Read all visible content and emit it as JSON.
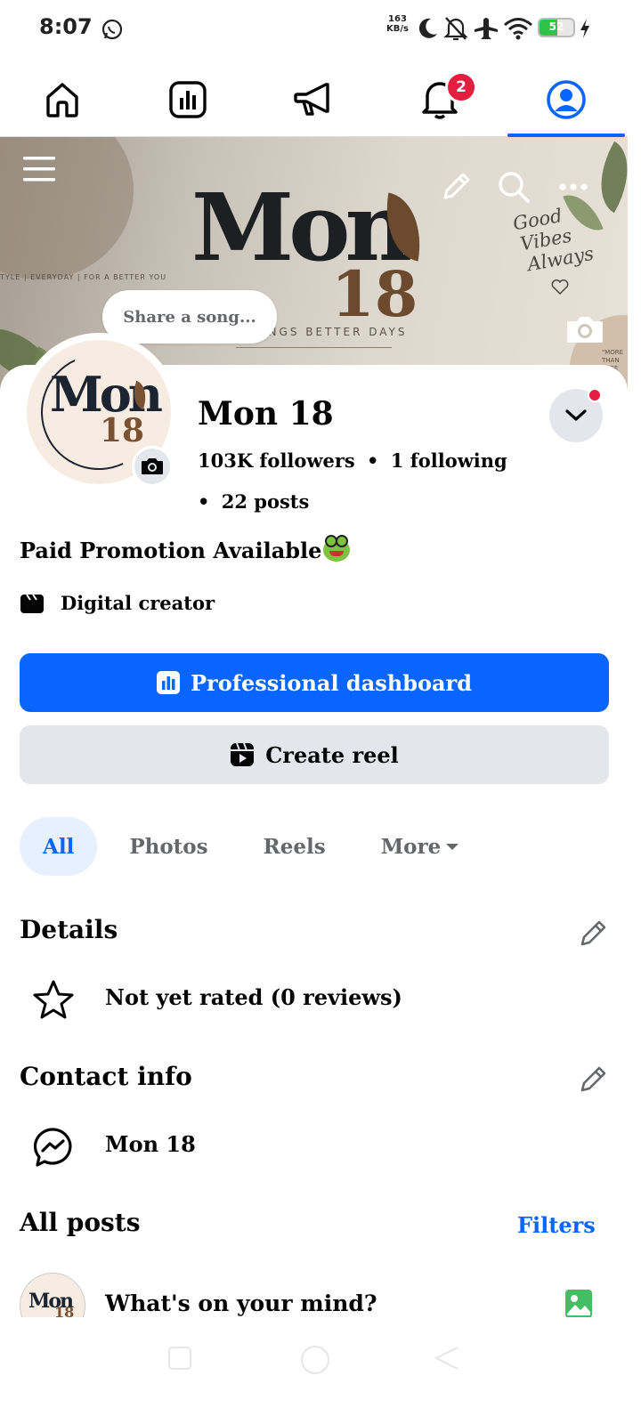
{
  "status_bar": {
    "time": "8:07",
    "net_speed_value": "163",
    "net_speed_unit": "KB/s",
    "battery": "52",
    "battery_level": 0.52,
    "icons": [
      "whatsapp-icon",
      "moon-icon",
      "bell-off-icon",
      "airplane-icon",
      "wifi-icon",
      "battery-icon",
      "charging-icon"
    ]
  },
  "top_nav": {
    "tabs": [
      {
        "name": "home",
        "icon": "home-icon"
      },
      {
        "name": "dashboard",
        "icon": "chart-icon"
      },
      {
        "name": "ads",
        "icon": "megaphone-icon"
      },
      {
        "name": "notifications",
        "icon": "bell-icon",
        "badge": "2"
      },
      {
        "name": "profile",
        "icon": "profile-icon",
        "active": true
      }
    ],
    "accent_color": "#0866ff"
  },
  "cover": {
    "brand": "Mon",
    "brand_number": "18",
    "left_line": "TYLE  |  EVERYDAY  |  FOR A BETTER YOU",
    "tagline": "INGS   BETTER DAYS",
    "script_line1": "Good",
    "script_line2": "Vibes",
    "script_line3": "Always",
    "small_text_1": "\"MORE",
    "small_text_2": "THAN",
    "small_text_3": "PAGE"
  },
  "share_song": "Share a song...",
  "profile": {
    "name": "Mon 18",
    "followers": "103K followers",
    "following": "1 following",
    "posts": "22 posts",
    "avatar_text": "Mon",
    "avatar_num": "18",
    "separator": "•",
    "bio": "Paid Promotion Available",
    "category": "Digital creator"
  },
  "actions": {
    "primary": "Professional dashboard",
    "secondary": "Create reel"
  },
  "filter_tabs": [
    "All",
    "Photos",
    "Reels",
    "More"
  ],
  "details": {
    "title": "Details",
    "rating": "Not yet rated (0 reviews)"
  },
  "contact": {
    "title": "Contact info",
    "messenger": "Mon 18"
  },
  "posts_section": {
    "title": "All posts",
    "filters": "Filters",
    "composer_placeholder": "What's on your mind?"
  }
}
